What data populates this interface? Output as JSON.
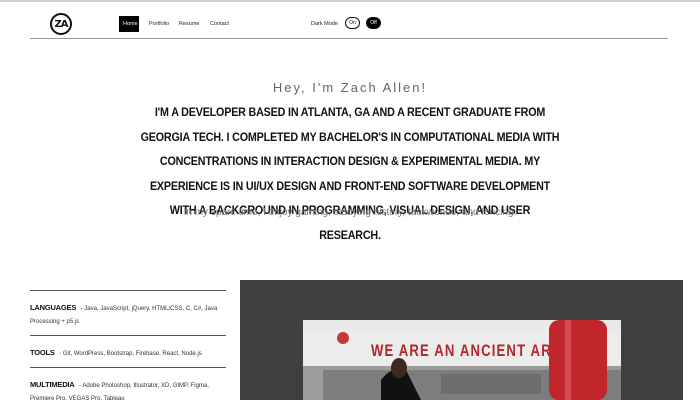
{
  "nav": {
    "logo_text": "ZA",
    "links": [
      {
        "label": "Home",
        "active": true
      },
      {
        "label": "Portfolio"
      },
      {
        "label": "Resume"
      },
      {
        "label": "Contact"
      }
    ],
    "dark_mode": {
      "label": "Dark Mode",
      "on_label": "On",
      "off_label": "Off",
      "selected": "Off"
    }
  },
  "hero": {
    "greeting": "Hey, I'm Zach Allen!",
    "bio": "I'm a developer based in Atlanta, GA and a recent graduate from Georgia Tech. I completed my Bachelor's in Computational Media with concentrations in Interaction Design & Experimental Media. My experience is in UI/UX design and front-end software development with a background in programming, visual design, and user research.",
    "hobbies": "In my spare time, I enjoy gaming, studying history, taekwondo, and fencing."
  },
  "skills": [
    {
      "title": "LANGUAGES",
      "items": "Java, JavaScript, jQuery, HTML/CSS, C, C#, Java Processing + p5.js"
    },
    {
      "title": "TOOLS",
      "items": "Git, WordPress, Bootstrap, Firebase, React, Node.js"
    },
    {
      "title": "MULTIMEDIA",
      "items": "Adobe Photoshop, Illustrator, XD, GIMP, Figma, Premiere Pro, VEGAS Pro, Tableau"
    }
  ],
  "media": {
    "banner_text": "WE ARE AN ANCIENT ART"
  },
  "colors": {
    "accent": "#000000",
    "media_bg": "#3f3f3f",
    "banner_red": "#b3262b"
  }
}
